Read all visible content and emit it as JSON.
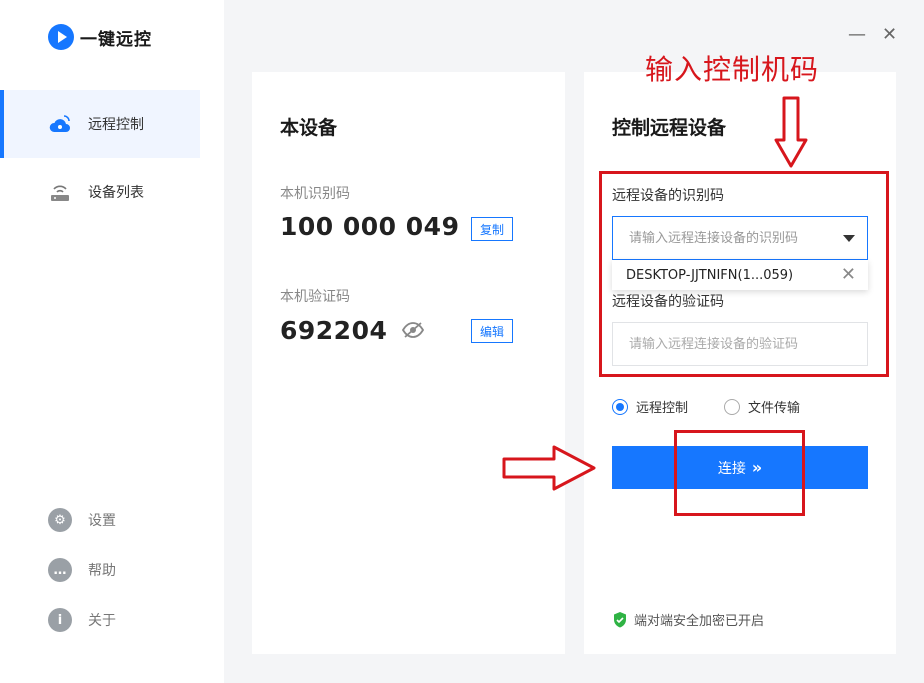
{
  "app": {
    "name": "一键远控"
  },
  "sidebar": {
    "items": [
      {
        "label": "远程控制"
      },
      {
        "label": "设备列表"
      }
    ],
    "bottom": [
      {
        "label": "设置"
      },
      {
        "label": "帮助"
      },
      {
        "label": "关于"
      }
    ]
  },
  "window": {
    "minimize": "—",
    "close": "✕"
  },
  "local": {
    "title": "本设备",
    "id_label": "本机识别码",
    "id_value": "100 000 049",
    "copy_label": "复制",
    "code_label": "本机验证码",
    "code_value": "692204",
    "edit_label": "编辑"
  },
  "remote": {
    "title": "控制远程设备",
    "id_label": "远程设备的识别码",
    "id_placeholder": "请输入远程连接设备的识别码",
    "history_item": "DESKTOP-JJTNIFN(1...059)",
    "code_label": "远程设备的验证码",
    "code_placeholder": "请输入远程连接设备的验证码",
    "mode_options": [
      "远程控制",
      "文件传输"
    ],
    "mode_selected": "远程控制",
    "connect_label": "连接",
    "secure_text": "端对端安全加密已开启"
  },
  "annotation": {
    "title": "输入控制机码"
  },
  "colors": {
    "accent": "#1677ff",
    "annotation_red": "#d7161c",
    "secure_green": "#2fb344"
  }
}
